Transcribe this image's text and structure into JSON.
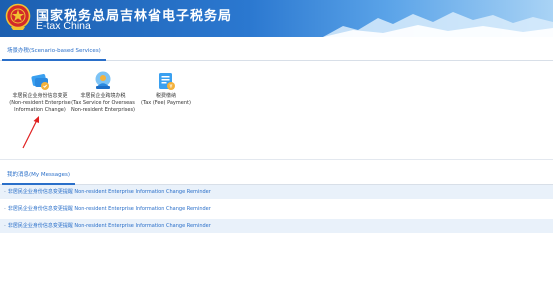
{
  "header": {
    "title_cn": "国家税务总局吉林省电子税务局",
    "title_en": "E-tax China"
  },
  "scenario": {
    "tab_label": "场景办税(Scenario-based Services)",
    "services": [
      {
        "icon": "id-card-icon",
        "line1": "非居民企业身份信息变更",
        "line2": "(Non-resident Enterprise",
        "line3": "Information Change)"
      },
      {
        "icon": "person-globe-icon",
        "line1": "非居民企业跨境办税",
        "line2": "(Tax Service for Overseas",
        "line3": "Non-resident Enterprises)"
      },
      {
        "icon": "tax-payment-icon",
        "line1": "税费缴纳",
        "line2": "(Tax (Fee) Payment)",
        "line3": ""
      }
    ]
  },
  "messages": {
    "tab_label": "我的消息(My Messages)",
    "items": [
      {
        "text": "非居民企业身份信息变更提醒 Non-resident Enterprise Information Change Reminder"
      },
      {
        "text": "非居民企业身份信息变更提醒 Non-resident Enterprise Information Change Reminder"
      },
      {
        "text": "非居民企业身份信息变更提醒 Non-resident Enterprise Information Change Reminder"
      }
    ]
  },
  "colors": {
    "brand_blue": "#2a6fc9",
    "header_dark": "#1c5fb0",
    "arrow_red": "#e02020"
  }
}
